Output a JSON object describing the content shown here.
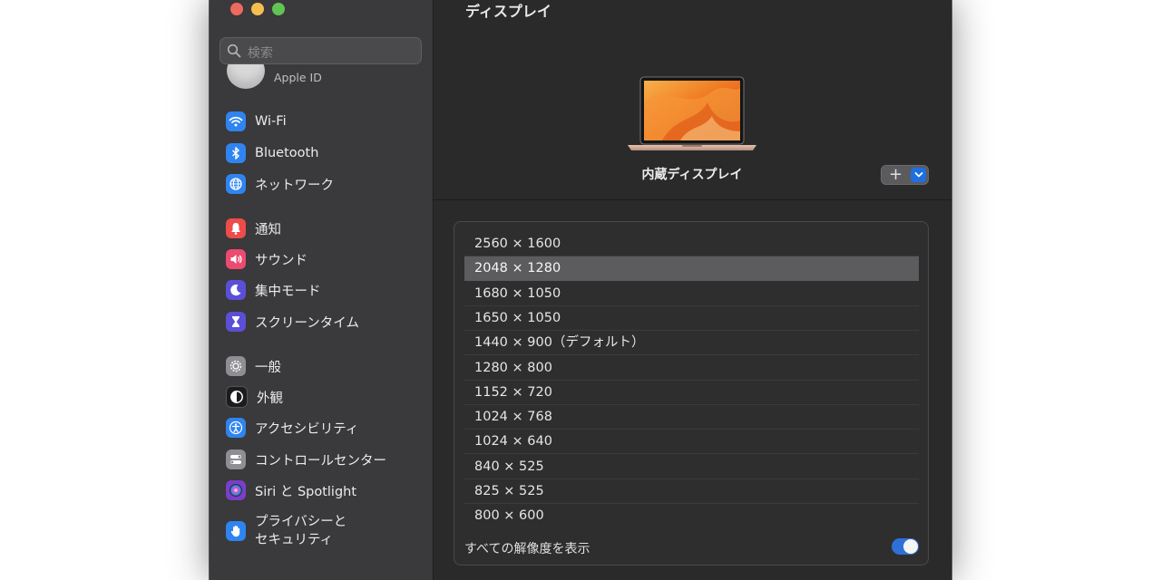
{
  "sidebar": {
    "search_placeholder": "検索",
    "apple_id_label": "Apple ID",
    "items": [
      {
        "label": "Wi-Fi",
        "icon": "wifi-icon",
        "color": "#2f84f0"
      },
      {
        "label": "Bluetooth",
        "icon": "bluetooth-icon",
        "color": "#2f84f0"
      },
      {
        "label": "ネットワーク",
        "icon": "globe-icon",
        "color": "#2f84f0"
      },
      {
        "label": "通知",
        "icon": "bell-icon",
        "color": "#ee4b4b"
      },
      {
        "label": "サウンド",
        "icon": "speaker-icon",
        "color": "#ec4a70"
      },
      {
        "label": "集中モード",
        "icon": "moon-icon",
        "color": "#5b4fd8"
      },
      {
        "label": "スクリーンタイム",
        "icon": "hourglass-icon",
        "color": "#5b4fd8"
      },
      {
        "label": "一般",
        "icon": "gear-icon",
        "color": "#8e8e93"
      },
      {
        "label": "外観",
        "icon": "appearance-icon",
        "color": "#1c1c1e"
      },
      {
        "label": "アクセシビリティ",
        "icon": "accessibility-icon",
        "color": "#2f84f0"
      },
      {
        "label": "コントロールセンター",
        "icon": "control-center-icon",
        "color": "#8e8e93"
      },
      {
        "label": "Siri と Spotlight",
        "icon": "siri-icon",
        "color": "#7a3fc8"
      },
      {
        "label": "プライバシーと\nセキュリティ",
        "icon": "hand-icon",
        "color": "#2f84f0"
      }
    ]
  },
  "main": {
    "title": "ディスプレイ",
    "display_name": "内蔵ディスプレイ",
    "add_button_label": "+",
    "resolutions": [
      "2560 × 1600",
      "2048 × 1280",
      "1680 × 1050",
      "1650 × 1050",
      "1440 × 900（デフォルト）",
      "1280 × 800",
      "1152 × 720",
      "1024 × 768",
      "1024 × 640",
      "840 × 525",
      "825 × 525",
      "800 × 600"
    ],
    "selected_resolution": "2048 × 1280",
    "show_all_label": "すべての解像度を表示",
    "show_all_enabled": true
  },
  "colors": {
    "accent": "#2f6fd8",
    "selection": "#5c5b5e"
  }
}
